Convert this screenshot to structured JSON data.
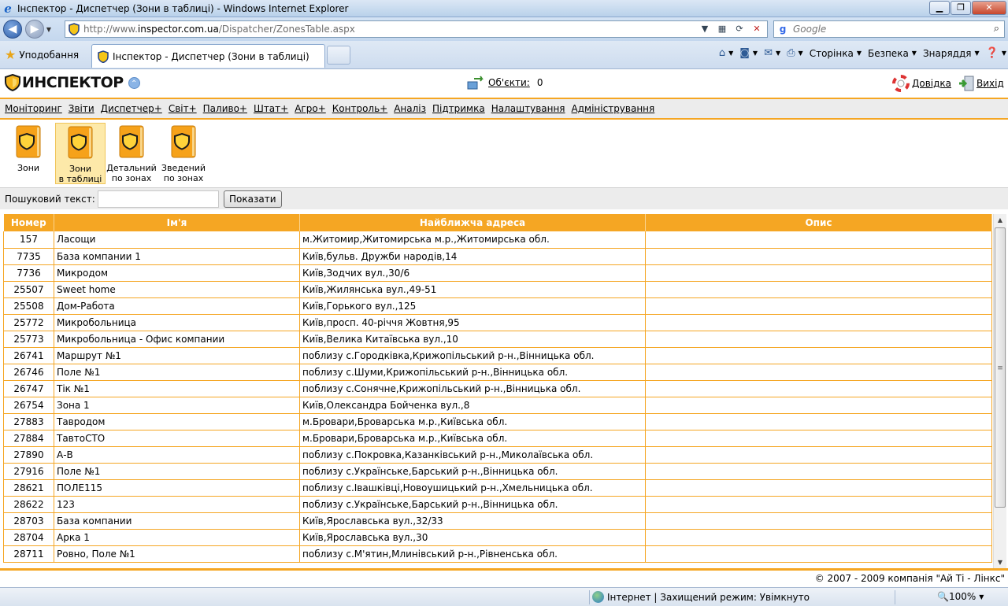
{
  "browser": {
    "window_title": "Інспектор - Диспетчер (Зони в таблиці) - Windows Internet Explorer",
    "url_prefix": "http://www.",
    "url_domain": "inspector.com.ua",
    "url_path": "/Dispatcher/ZonesTable.aspx",
    "search_placeholder": "Google",
    "favorites_label": "Уподобання",
    "tab_title": "Інспектор - Диспетчер (Зони в таблиці)",
    "cmd_page": "Сторінка",
    "cmd_safety": "Безпека",
    "cmd_tools": "Знаряддя",
    "status_zone": "Інтернет | Захищений режим: Увімкнуто",
    "status_zoom": "100%"
  },
  "header": {
    "logo_text": "ИНСПЕКТОР",
    "objects_label": "Об'єкти:",
    "objects_count": "0",
    "help_label": "Довідка",
    "exit_label": "Вихід"
  },
  "menu": {
    "items": [
      "Моніторинг",
      "Звіти",
      "Диспетчер+",
      "Світ+",
      "Паливо+",
      "Штат+",
      "Агро+",
      "Контроль+",
      "Аналіз",
      "Підтримка",
      "Налаштування",
      "Адміністрування"
    ]
  },
  "tools": {
    "zones_l1": "Зони",
    "zones_table_l1": "Зони",
    "zones_table_l2": "в таблиці",
    "detailed_l1": "Детальний",
    "detailed_l2": "по зонах",
    "summary_l1": "Зведений",
    "summary_l2": "по зонах"
  },
  "search": {
    "label": "Пошуковий текст:",
    "value": "",
    "button": "Показати"
  },
  "table": {
    "columns": [
      "Номер",
      "Ім'я",
      "Найближча адреса",
      "Опис"
    ],
    "rows": [
      [
        "157",
        "Ласощи",
        "м.Житомир,Житомирська м.р.,Житомирська обл.",
        ""
      ],
      [
        "7735",
        "База компании 1",
        "Київ,бульв. Дружби народів,14",
        ""
      ],
      [
        "7736",
        "Микродом",
        "Київ,Зодчих вул.,30/6",
        ""
      ],
      [
        "25507",
        "Sweet home",
        "Київ,Жилянська вул.,49-51",
        ""
      ],
      [
        "25508",
        "Дом-Работа",
        "Київ,Горького вул.,125",
        ""
      ],
      [
        "25772",
        "Микробольница",
        "Київ,просп. 40-річчя Жовтня,95",
        ""
      ],
      [
        "25773",
        "Микробольница - Офис компании",
        "Київ,Велика Китаївська вул.,10",
        ""
      ],
      [
        "26741",
        "Маршрут №1",
        "поблизу с.Городківка,Крижопільський р-н.,Вінницька обл.",
        ""
      ],
      [
        "26746",
        "Поле №1",
        "поблизу с.Шуми,Крижопільський р-н.,Вінницька обл.",
        ""
      ],
      [
        "26747",
        "Тік №1",
        "поблизу с.Сонячне,Крижопільський р-н.,Вінницька обл.",
        ""
      ],
      [
        "26754",
        "Зона 1",
        "Київ,Олександра Бойченка вул.,8",
        ""
      ],
      [
        "27883",
        "Тавродом",
        "м.Бровари,Броварська м.р.,Київська обл.",
        ""
      ],
      [
        "27884",
        "ТавтоСТО",
        "м.Бровари,Броварська м.р.,Київська обл.",
        ""
      ],
      [
        "27890",
        "А-В",
        "поблизу с.Покровка,Казанківський р-н.,Миколаївська обл.",
        ""
      ],
      [
        "27916",
        "Поле №1",
        "поблизу с.Українське,Барський р-н.,Вінницька обл.",
        ""
      ],
      [
        "28621",
        "ПОЛЕ115",
        "поблизу с.Івашківці,Новоушицький р-н.,Хмельницька обл.",
        ""
      ],
      [
        "28622",
        "123",
        "поблизу с.Українське,Барський р-н.,Вінницька обл.",
        ""
      ],
      [
        "28703",
        "База компании",
        "Київ,Ярославська вул.,32/33",
        ""
      ],
      [
        "28704",
        "Арка 1",
        "Київ,Ярославська вул.,30",
        ""
      ],
      [
        "28711",
        "Ровно, Поле №1",
        "поблизу с.М'ятин,Млинівський р-н.,Рівненська обл.",
        ""
      ]
    ]
  },
  "footer": {
    "copyright": "© 2007 - 2009 компанія \"Ай Ті - Лінкс\""
  },
  "colors": {
    "accent": "#f5a623",
    "menu_bg": "#ececec",
    "active_tool_bg": "#fde9a9"
  }
}
